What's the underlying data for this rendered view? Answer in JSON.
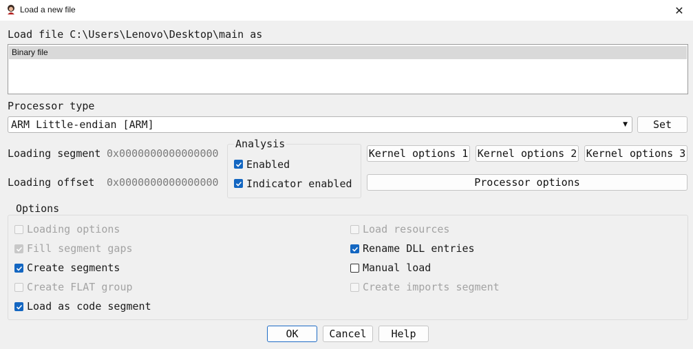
{
  "window": {
    "title": "Load a new file",
    "close_glyph": "✕"
  },
  "load_file_label": "Load file C:\\Users\\Lenovo\\Desktop\\main as",
  "file_types": [
    "Binary file"
  ],
  "processor": {
    "label": "Processor type",
    "selected": "ARM Little-endian [ARM]",
    "set_button": "Set"
  },
  "segment": {
    "loading_segment_label": "Loading segment",
    "loading_segment_value": "0x0000000000000000",
    "loading_offset_label": "Loading offset",
    "loading_offset_value": "0x0000000000000000"
  },
  "analysis": {
    "title": "Analysis",
    "enabled": {
      "label": "Enabled",
      "checked": true
    },
    "indicator": {
      "label": "Indicator enabled",
      "checked": true
    }
  },
  "kernel_buttons": [
    "Kernel options 1",
    "Kernel options 2",
    "Kernel options 3"
  ],
  "processor_options_button": "Processor options",
  "options": {
    "title": "Options",
    "loading_options": {
      "label": "Loading options",
      "checked": false,
      "enabled": false
    },
    "fill_segment_gaps": {
      "label": "Fill segment gaps",
      "checked": true,
      "enabled": false
    },
    "create_segments": {
      "label": "Create segments",
      "checked": true,
      "enabled": true
    },
    "create_flat_group": {
      "label": "Create FLAT group",
      "checked": false,
      "enabled": false
    },
    "load_as_code_segment": {
      "label": "Load as code segment",
      "checked": true,
      "enabled": true
    },
    "load_resources": {
      "label": "Load resources",
      "checked": false,
      "enabled": false
    },
    "rename_dll_entries": {
      "label": "Rename DLL entries",
      "checked": true,
      "enabled": true
    },
    "manual_load": {
      "label": "Manual load",
      "checked": false,
      "enabled": true
    },
    "create_imports_segment": {
      "label": "Create imports segment",
      "checked": false,
      "enabled": false
    }
  },
  "footer": {
    "ok": "OK",
    "cancel": "Cancel",
    "help": "Help"
  },
  "colors": {
    "accent": "#1366c1",
    "default_button_border": "#1d6ac4",
    "selection": "#d9d9d9"
  }
}
